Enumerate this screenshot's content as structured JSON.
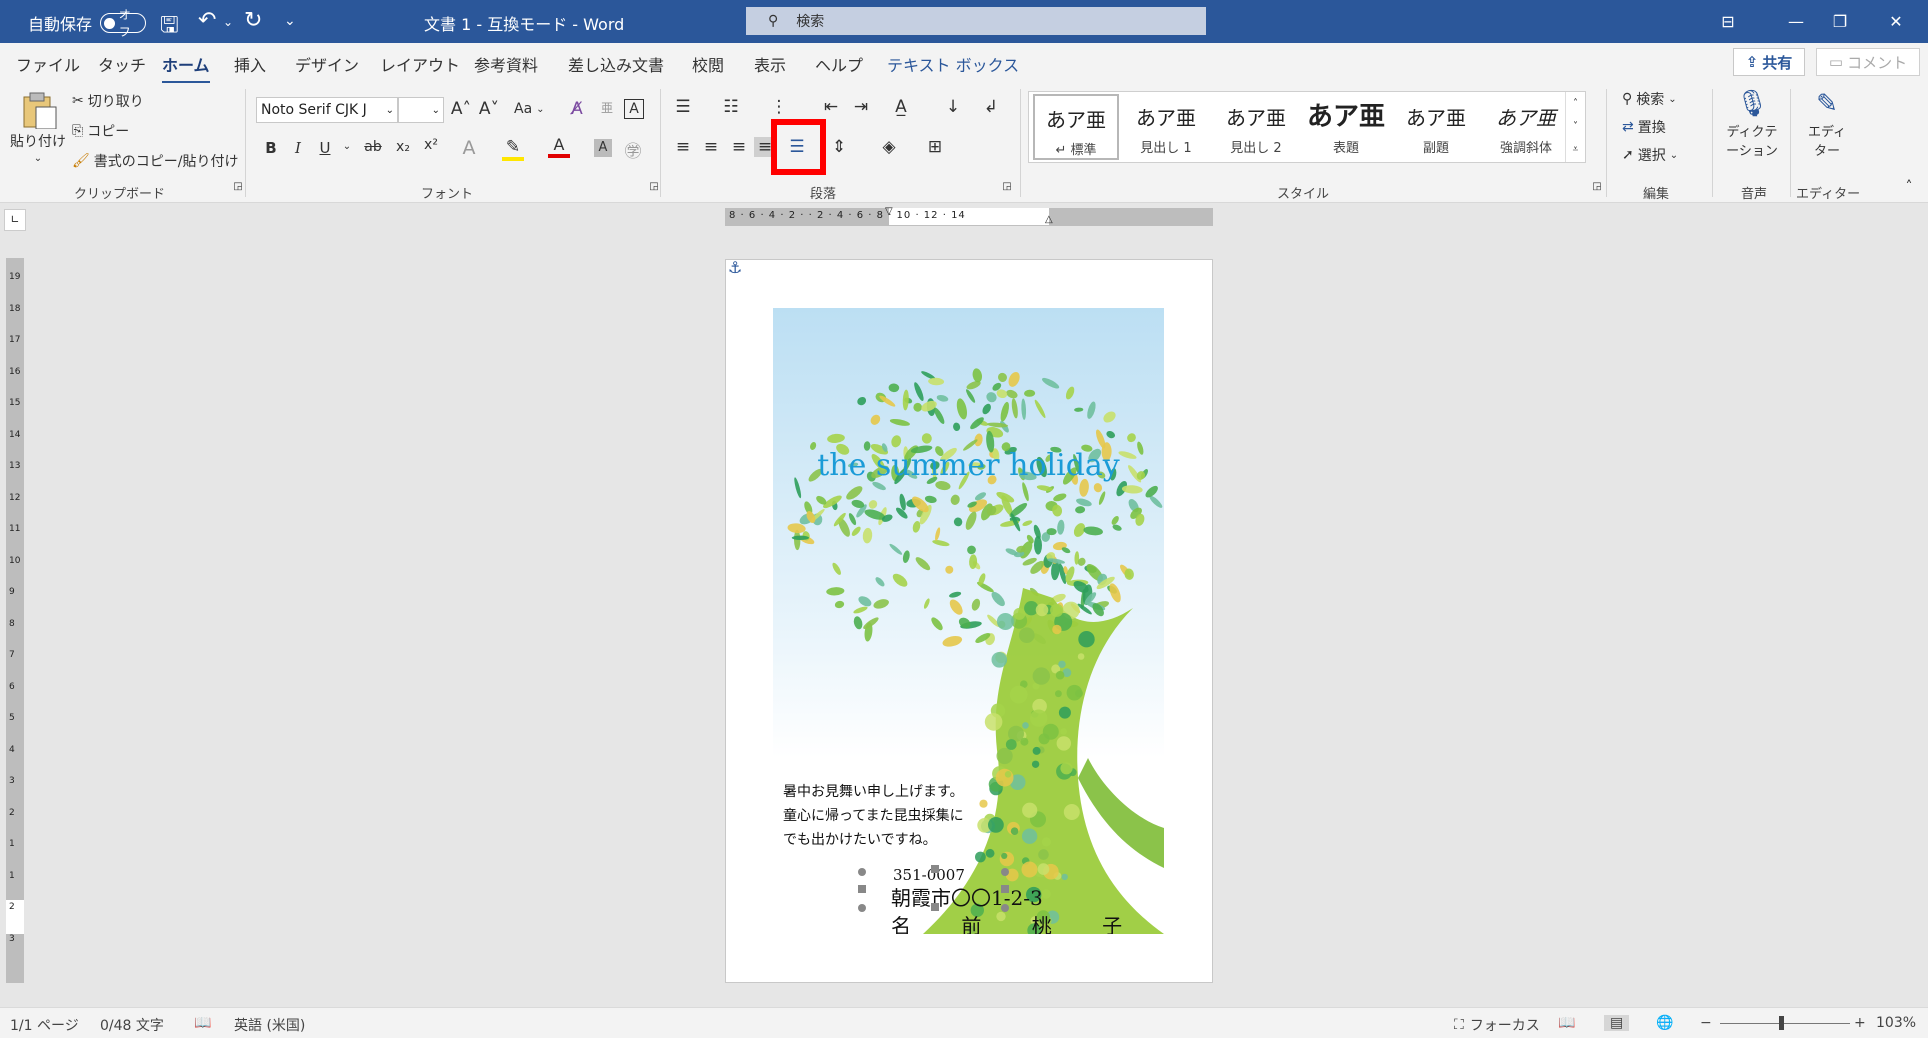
{
  "titlebar": {
    "autosave_label": "自動保存",
    "autosave_state": "オフ",
    "doc_title": "文書 1 - 互換モード - Word",
    "search_placeholder": "検索"
  },
  "tabs": [
    "ファイル",
    "タッチ",
    "ホーム",
    "挿入",
    "デザイン",
    "レイアウト",
    "参考資料",
    "差し込み文書",
    "校閲",
    "表示",
    "ヘルプ",
    "テキスト ボックス"
  ],
  "share_label": "共有",
  "comment_label": "コメント",
  "clipboard": {
    "paste": "貼り付け",
    "cut": "切り取り",
    "copy": "コピー",
    "format_painter": "書式のコピー/貼り付け",
    "group": "クリップボード"
  },
  "font": {
    "name": "Noto Serif CJK J",
    "size": "",
    "case_label": "Aa",
    "group": "フォント"
  },
  "paragraph": {
    "group": "段落"
  },
  "styles": {
    "items": [
      {
        "preview": "あア亜",
        "name": "↵ 標準"
      },
      {
        "preview": "あア亜",
        "name": "見出し 1"
      },
      {
        "preview": "あア亜",
        "name": "見出し 2"
      },
      {
        "preview": "あア亜",
        "name": "表題"
      },
      {
        "preview": "あア亜",
        "name": "副題"
      },
      {
        "preview": "あア亜",
        "name": "強調斜体"
      }
    ],
    "group": "スタイル"
  },
  "editing": {
    "find": "検索",
    "replace": "置換",
    "select": "選択",
    "group": "編集"
  },
  "voice": {
    "dictate": "ディクテーション",
    "group": "音声"
  },
  "editor": {
    "label": "エディター",
    "group": "エディター"
  },
  "hruler_ticks": "8 · 6 · 4 · 2 · · 2 · 4 · 6 · 8 · 10 · 12 · 14",
  "vruler_ticks": "19 18 17 16 15 14 13 12 11 10 9 8 7 6 5 4 3 2 1 1 2 3",
  "card": {
    "title": "the summer holiday",
    "greeting": [
      "暑中お見舞い申し上げます。",
      "童心に帰ってまた昆虫採集に",
      "でも出かけたいですね。"
    ],
    "zip": "351-0007",
    "address": "朝霞市〇〇1-2-3",
    "name": "名 前 桃 子"
  },
  "status": {
    "page": "1/1 ページ",
    "words": "0/48 文字",
    "language": "英語 (米国)",
    "focus": "フォーカス",
    "zoom": "103%"
  }
}
